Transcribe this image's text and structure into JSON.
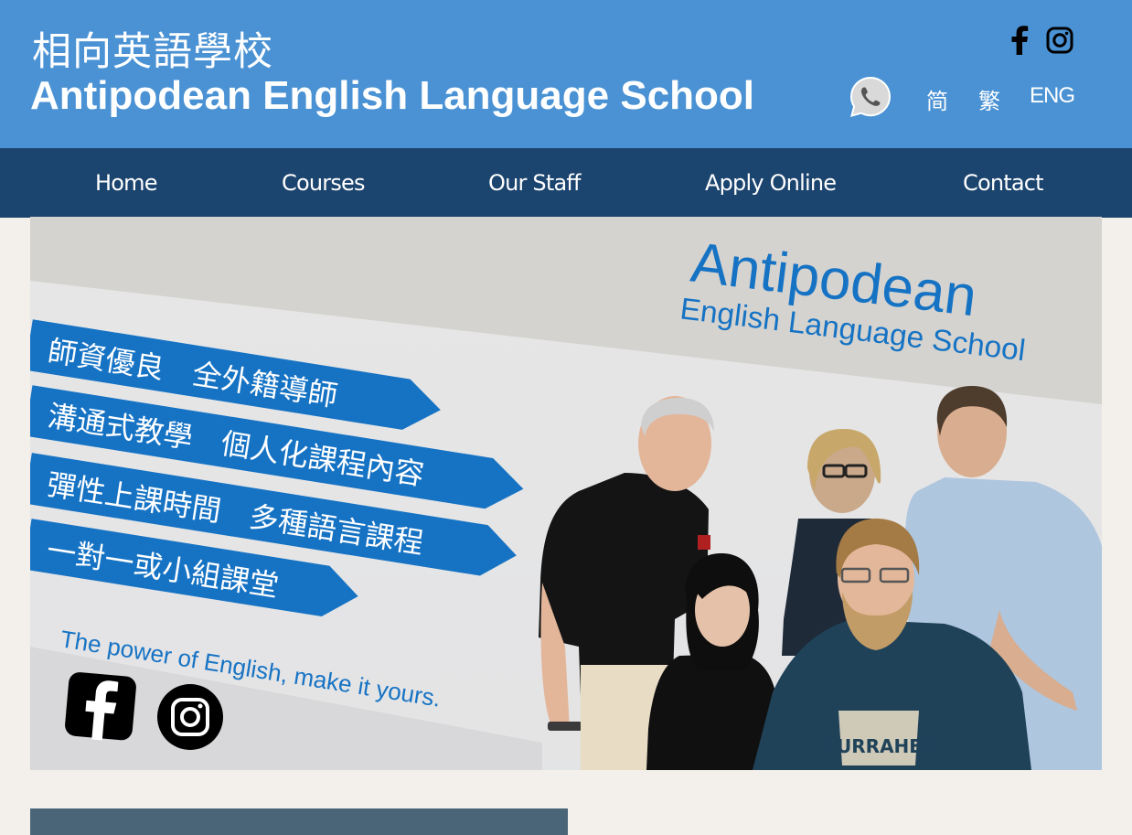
{
  "header": {
    "title_cn": "相向英語學校",
    "title_en": "Antipodean English Language School",
    "social": [
      "facebook-icon",
      "instagram-icon"
    ],
    "whatsapp_icon": "whatsapp-icon",
    "languages": [
      "简",
      "繁",
      "ENG"
    ]
  },
  "nav": {
    "items": [
      "Home",
      "Courses",
      "Our Staff",
      "Apply Online",
      "Contact"
    ]
  },
  "banner": {
    "brand_line1": "Antipodean",
    "brand_line2": "English Language School",
    "ribbons": [
      "師資優良　全外籍導師",
      "溝通式教學　個人化課程內容",
      "彈性上課時間　多種語言課程",
      "一對一或小組課堂"
    ],
    "tagline": "The power of English, make it yours.",
    "shirt_text": "CURRAHEE",
    "icons": [
      "facebook-icon",
      "instagram-icon"
    ]
  },
  "colors": {
    "header_bg": "#4a92d4",
    "nav_bg": "#1b446e",
    "page_bg": "#f3efeb",
    "ribbon_blue": "#1673c4",
    "bottom_box": "#4a6577"
  }
}
